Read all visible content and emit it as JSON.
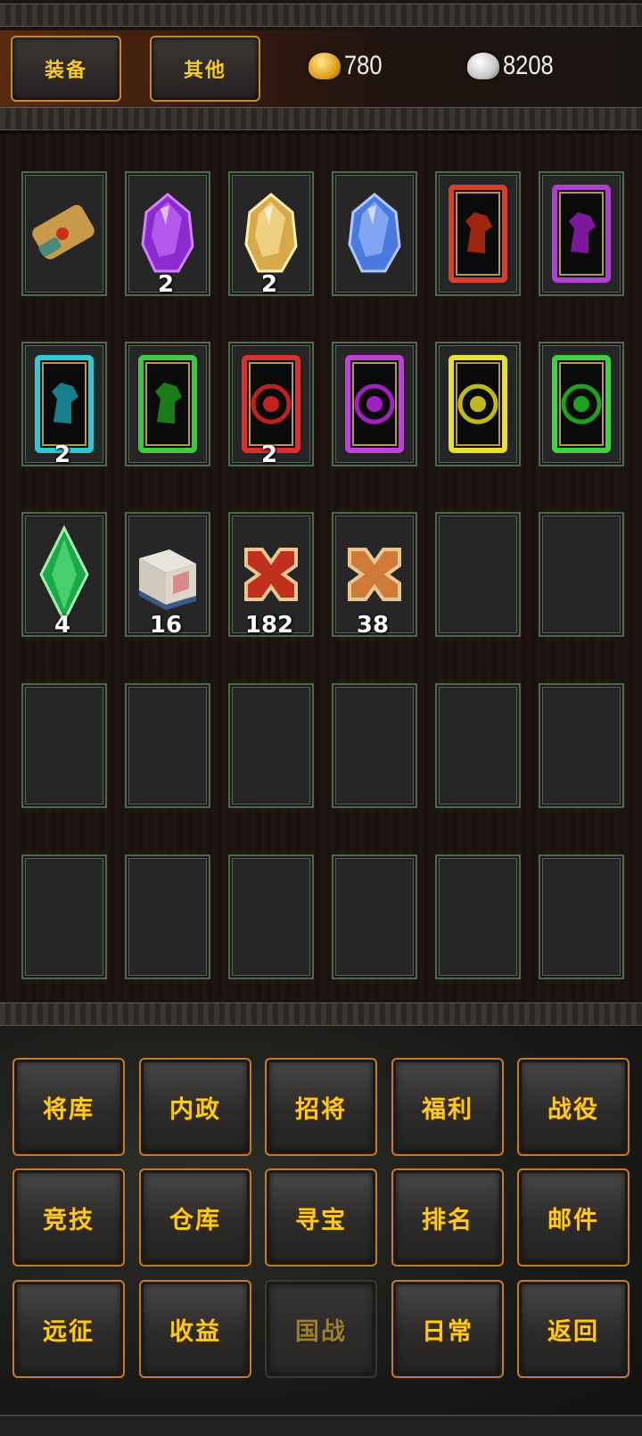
{
  "header": {
    "tabs": [
      {
        "label": "装备"
      },
      {
        "label": "其他"
      }
    ],
    "gold": {
      "icon": "gold-ingot-icon",
      "value": "780"
    },
    "silver": {
      "icon": "silver-ingot-icon",
      "value": "8208"
    }
  },
  "inventory": {
    "slots": [
      {
        "item": "scroll-item-icon",
        "count": ""
      },
      {
        "item": "purple-crystal-item-icon",
        "count": "2"
      },
      {
        "item": "gold-crystal-item-icon",
        "count": "2"
      },
      {
        "item": "blue-crystal-item-icon",
        "count": ""
      },
      {
        "item": "red-horse-card-item-icon",
        "count": ""
      },
      {
        "item": "purple-horse-card-item-icon",
        "count": ""
      },
      {
        "item": "cyan-horse-card-item-icon",
        "count": "2"
      },
      {
        "item": "green-horse-card-item-icon",
        "count": ""
      },
      {
        "item": "red-seal-card-item-icon",
        "count": "2"
      },
      {
        "item": "purple-seal-card-item-icon",
        "count": ""
      },
      {
        "item": "yellow-seal-card-item-icon",
        "count": ""
      },
      {
        "item": "green-seal-card-item-icon",
        "count": ""
      },
      {
        "item": "green-gem-item-icon",
        "count": "4"
      },
      {
        "item": "book-item-icon",
        "count": "16"
      },
      {
        "item": "red-cross-token-item-icon",
        "count": "182"
      },
      {
        "item": "orange-cross-token-item-icon",
        "count": "38"
      },
      {
        "item": "",
        "count": ""
      },
      {
        "item": "",
        "count": ""
      },
      {
        "item": "",
        "count": ""
      },
      {
        "item": "",
        "count": ""
      },
      {
        "item": "",
        "count": ""
      },
      {
        "item": "",
        "count": ""
      },
      {
        "item": "",
        "count": ""
      },
      {
        "item": "",
        "count": ""
      },
      {
        "item": "",
        "count": ""
      },
      {
        "item": "",
        "count": ""
      },
      {
        "item": "",
        "count": ""
      },
      {
        "item": "",
        "count": ""
      },
      {
        "item": "",
        "count": ""
      },
      {
        "item": "",
        "count": ""
      }
    ]
  },
  "menu": {
    "buttons": [
      {
        "label": "将库",
        "enabled": true
      },
      {
        "label": "内政",
        "enabled": true
      },
      {
        "label": "招将",
        "enabled": true
      },
      {
        "label": "福利",
        "enabled": true
      },
      {
        "label": "战役",
        "enabled": true
      },
      {
        "label": "竞技",
        "enabled": true
      },
      {
        "label": "仓库",
        "enabled": true
      },
      {
        "label": "寻宝",
        "enabled": true
      },
      {
        "label": "排名",
        "enabled": true
      },
      {
        "label": "邮件",
        "enabled": true
      },
      {
        "label": "远征",
        "enabled": true
      },
      {
        "label": "收益",
        "enabled": true
      },
      {
        "label": "国战",
        "enabled": false
      },
      {
        "label": "日常",
        "enabled": true
      },
      {
        "label": "返回",
        "enabled": true
      }
    ]
  },
  "colors": {
    "accent": "#f4cc24",
    "frame": "#c87a22",
    "slot_border": "#4e6a48"
  }
}
